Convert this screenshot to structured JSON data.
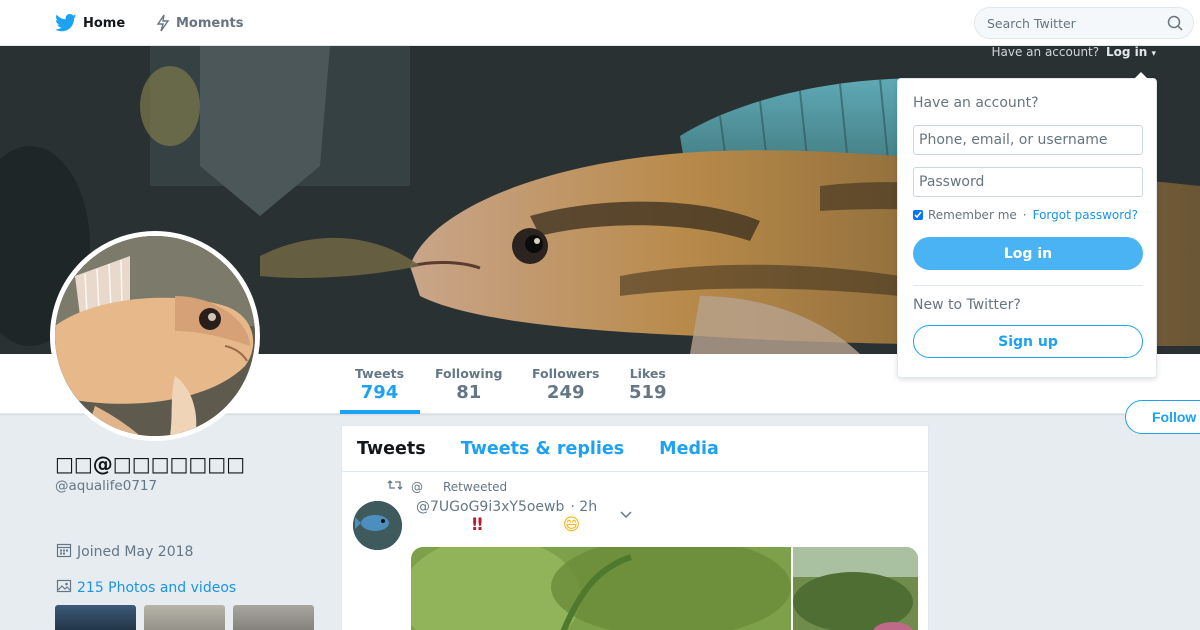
{
  "nav": {
    "home_label": "Home",
    "moments_label": "Moments",
    "search_placeholder": "Search Twitter"
  },
  "account_prompt": {
    "text": "Have an account?",
    "login_label": "Log in"
  },
  "stats": [
    {
      "label": "Tweets",
      "value": "794"
    },
    {
      "label": "Following",
      "value": "81"
    },
    {
      "label": "Followers",
      "value": "249"
    },
    {
      "label": "Likes",
      "value": "519"
    }
  ],
  "follow_label": "Follow",
  "profile": {
    "name": "□□@□□□□□□□",
    "handle": "@aqualife0717",
    "joined": "Joined May 2018",
    "photos": "215 Photos and videos"
  },
  "timeline": {
    "tabs": [
      "Tweets",
      "Tweets & replies",
      "Media"
    ],
    "tweet": {
      "retweet_at": "@",
      "retweet_label": "Retweeted",
      "author": "@7UGoG9i3xY5oewb",
      "time": "· 2h",
      "text_emoji_1": "‼",
      "text_emoji_2": "😄"
    }
  },
  "login": {
    "title": "Have an account?",
    "username_placeholder": "Phone, email, or username",
    "password_placeholder": "Password",
    "remember_label": "Remember me",
    "separator": "·",
    "forgot_label": "Forgot password?",
    "login_button": "Log in",
    "new_label": "New to Twitter?",
    "signup_button": "Sign up"
  },
  "colors": {
    "accent": "#1da1f2",
    "login_button": "#4ab3f4",
    "background": "#e6ecf0"
  }
}
